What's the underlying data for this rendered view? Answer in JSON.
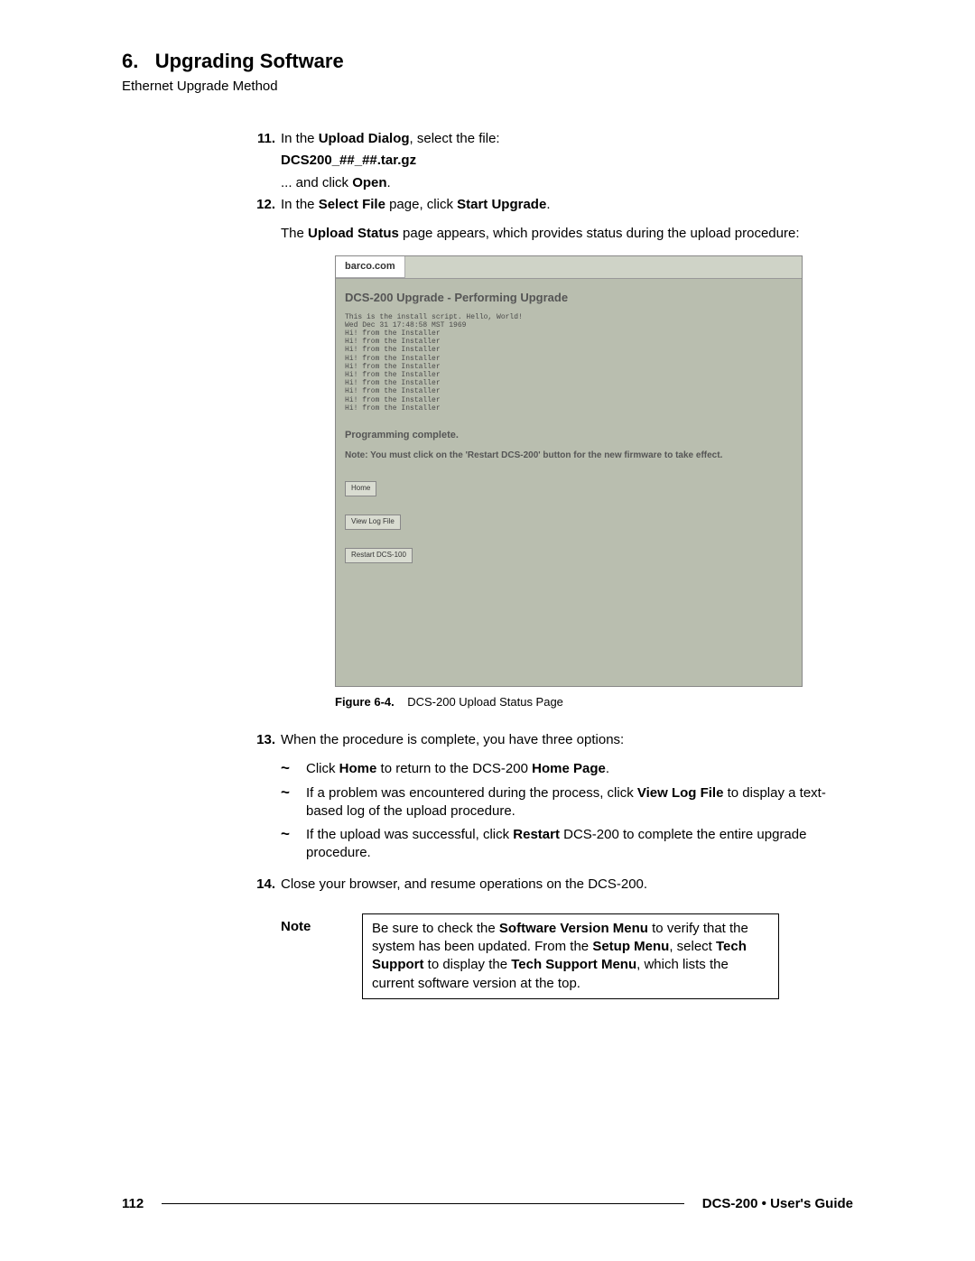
{
  "heading_number": "6.",
  "heading_title": "Upgrading Software",
  "subheading": "Ethernet Upgrade Method",
  "steps": {
    "s11": {
      "num": "11.",
      "line1_a": "In the ",
      "line1_b": "Upload Dialog",
      "line1_c": ", select the file:",
      "file": "DCS200_##_##.tar.gz",
      "line2_a": "... and click ",
      "line2_b": "Open",
      "line2_c": "."
    },
    "s12": {
      "num": "12.",
      "line1_a": "In the ",
      "line1_b": "Select File",
      "line1_c": " page, click ",
      "line1_d": "Start Upgrade",
      "line1_e": ".",
      "line2_a": "The ",
      "line2_b": "Upload Status",
      "line2_c": " page appears, which provides status during the upload procedure:"
    },
    "s13": {
      "num": "13.",
      "intro": "When the procedure is complete, you have three options:",
      "b1_a": "Click ",
      "b1_b": "Home",
      "b1_c": " to return to the DCS-200 ",
      "b1_d": "Home Page",
      "b1_e": ".",
      "b2_a": "If a problem was encountered during the process, click ",
      "b2_b": "View Log File",
      "b2_c": " to display a text-based log of the upload procedure.",
      "b3_a": "If the upload was successful, click ",
      "b3_b": "Restart",
      "b3_c": " DCS-200 to complete the entire upgrade procedure."
    },
    "s14": {
      "num": "14.",
      "text": "Close your browser, and resume operations on the DCS-200."
    }
  },
  "screenshot": {
    "tab": "barco.com",
    "title": "DCS-200 Upgrade - Performing Upgrade",
    "log": "This is the install script.  Hello, World!\nWed Dec 31 17:48:58 MST 1969\nHi! from the Installer\nHi! from the Installer\nHi! from the Installer\nHi! from the Installer\nHi! from the Installer\nHi! from the Installer\nHi! from the Installer\nHi! from the Installer\nHi! from the Installer\nHi! from the Installer",
    "prog_complete": "Programming complete.",
    "note": "Note: You must click on the 'Restart  DCS-200'  button for the new firmware to take effect.",
    "btn_home": "Home",
    "btn_viewlog": "View Log File",
    "btn_restart": "Restart DCS-100"
  },
  "figure": {
    "lead": "Figure 6-4.",
    "text": "DCS-200 Upload Status Page"
  },
  "note_block": {
    "label": "Note",
    "t1": "Be sure to check the ",
    "t2": "Software Version Menu",
    "t3": " to verify that the system has been updated.  From the ",
    "t4": "Setup Menu",
    "t5": ", select ",
    "t6": "Tech Support",
    "t7": " to display the ",
    "t8": "Tech Support Menu",
    "t9": ", which lists the current software version at the top."
  },
  "footer": {
    "page": "112",
    "product": "DCS-200",
    "sep": " • ",
    "doc": "User's Guide"
  },
  "bullet_glyph": "~"
}
